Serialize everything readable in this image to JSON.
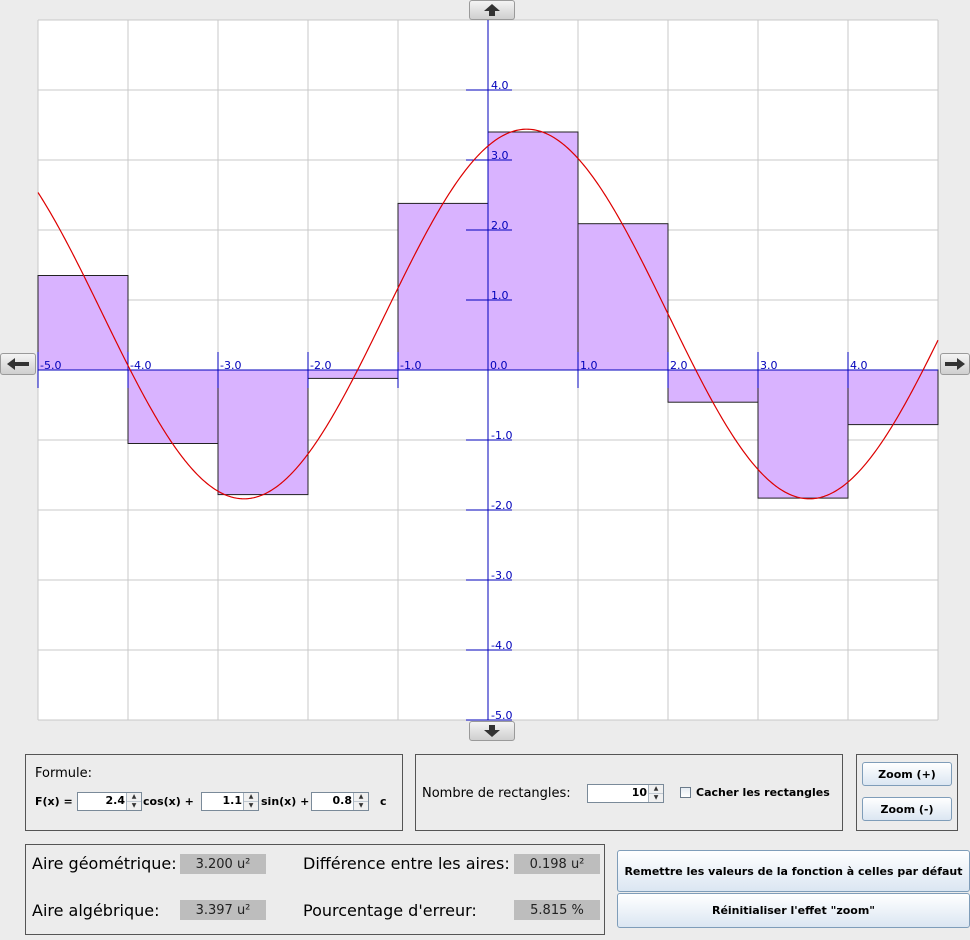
{
  "nav": {
    "up_icon": "arrow-up-icon",
    "down_icon": "arrow-down-icon",
    "left_icon": "arrow-left-icon",
    "right_icon": "arrow-right-icon"
  },
  "chart_data": {
    "type": "line",
    "xlim": [
      -5,
      5
    ],
    "ylim": [
      -5,
      5
    ],
    "grid": true,
    "x_tick_labels": [
      "-5.0",
      "-4.0",
      "-3.0",
      "-2.0",
      "-1.0",
      "0.0",
      "1.0",
      "2.0",
      "3.0",
      "4.0"
    ],
    "y_tick_labels": [
      "4.0",
      "3.0",
      "2.0",
      "1.0",
      "-1.0",
      "-2.0",
      "-3.0",
      "-4.0",
      "-5.0"
    ],
    "function": {
      "a": 2.4,
      "b": 1.1,
      "c": 0.8,
      "form": "a*cos(x) + b*sin(x) + c"
    },
    "rectangles": [
      {
        "x0": -5,
        "x1": -4,
        "height": 1.35
      },
      {
        "x0": -4,
        "x1": -3,
        "height": -1.05
      },
      {
        "x0": -3,
        "x1": -2,
        "height": -1.78
      },
      {
        "x0": -2,
        "x1": -1,
        "height": -0.12
      },
      {
        "x0": -1,
        "x1": 0,
        "height": 2.38
      },
      {
        "x0": 0,
        "x1": 1,
        "height": 3.4
      },
      {
        "x0": 1,
        "x1": 2,
        "height": 2.09
      },
      {
        "x0": 2,
        "x1": 3,
        "height": -0.46
      },
      {
        "x0": 3,
        "x1": 4,
        "height": -1.83
      },
      {
        "x0": 4,
        "x1": 5,
        "height": -0.78
      }
    ],
    "colors": {
      "curve": "#dd0000",
      "rect_fill": "#d9b3ff",
      "axis": "#0000bb",
      "grid": "#c8c8c8"
    }
  },
  "formula": {
    "title": "Formule:",
    "fx_label": "F(x) =",
    "a": "2.4",
    "cos_label": "cos(x) +",
    "b": "1.1",
    "sin_label": "sin(x) +",
    "c": "0.8",
    "c_label": "c"
  },
  "rect_panel": {
    "label": "Nombre de rectangles:",
    "count": "10",
    "hide_label": "Cacher les rectangles",
    "hide_checked": false
  },
  "zoom": {
    "in_label": "Zoom (+)",
    "out_label": "Zoom (-)"
  },
  "results": {
    "geo_label": "Aire géométrique:",
    "geo_value": "3.200 u²",
    "alg_label": "Aire algébrique:",
    "alg_value": "3.397 u²",
    "diff_label": "Différence entre les aires:",
    "diff_value": "0.198 u²",
    "err_label": "Pourcentage d'erreur:",
    "err_value": "5.815 %"
  },
  "actions": {
    "reset_label": "Remettre les valeurs de la fonction à celles par défaut",
    "zoom_reset_label": "Réinitialiser l'effet \"zoom\""
  }
}
